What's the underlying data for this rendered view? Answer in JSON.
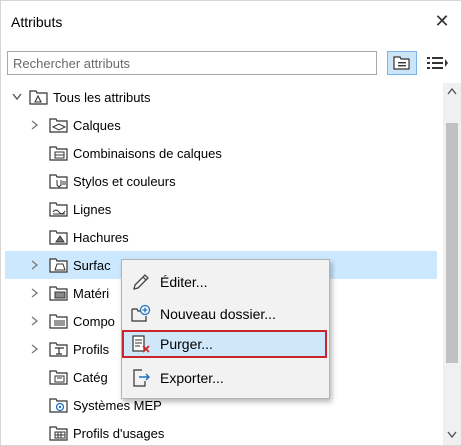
{
  "window": {
    "title": "Attributs",
    "close_glyph": "✕"
  },
  "search": {
    "placeholder": "Rechercher attributs",
    "value": ""
  },
  "toolbar": {
    "view_icon": "folder-view-icon",
    "list_icon": "list-view-icon"
  },
  "tree": {
    "root": "Tous les attributs",
    "items": [
      {
        "label": "Calques",
        "icon": "layers-icon"
      },
      {
        "label": "Combinaisons de calques",
        "icon": "layer-combinations-icon"
      },
      {
        "label": "Stylos et couleurs",
        "icon": "pens-colors-icon"
      },
      {
        "label": "Lignes",
        "icon": "lines-icon"
      },
      {
        "label": "Hachures",
        "icon": "hatches-icon"
      },
      {
        "label": "Surfac",
        "icon": "surfaces-icon"
      },
      {
        "label": "Matéri",
        "icon": "materials-icon"
      },
      {
        "label": "Compo",
        "icon": "composites-icon"
      },
      {
        "label": "Profils",
        "icon": "profiles-icon"
      },
      {
        "label": "Catég",
        "icon": "categories-icon"
      },
      {
        "label": "Systèmes MEP",
        "icon": "mep-systems-icon"
      },
      {
        "label": "Profils d'usages",
        "icon": "usage-profiles-icon"
      }
    ]
  },
  "context_menu": {
    "items": [
      {
        "label": "Éditer...",
        "icon": "pencil-icon"
      },
      {
        "label": "Nouveau dossier...",
        "icon": "new-folder-icon"
      },
      {
        "label": "Purger...",
        "icon": "purge-icon"
      },
      {
        "label": "Exporter...",
        "icon": "export-icon"
      }
    ],
    "highlight_color": "#c8262c"
  },
  "colors": {
    "accent": "#cce8ff",
    "icon_blue": "#1e6fc0"
  }
}
